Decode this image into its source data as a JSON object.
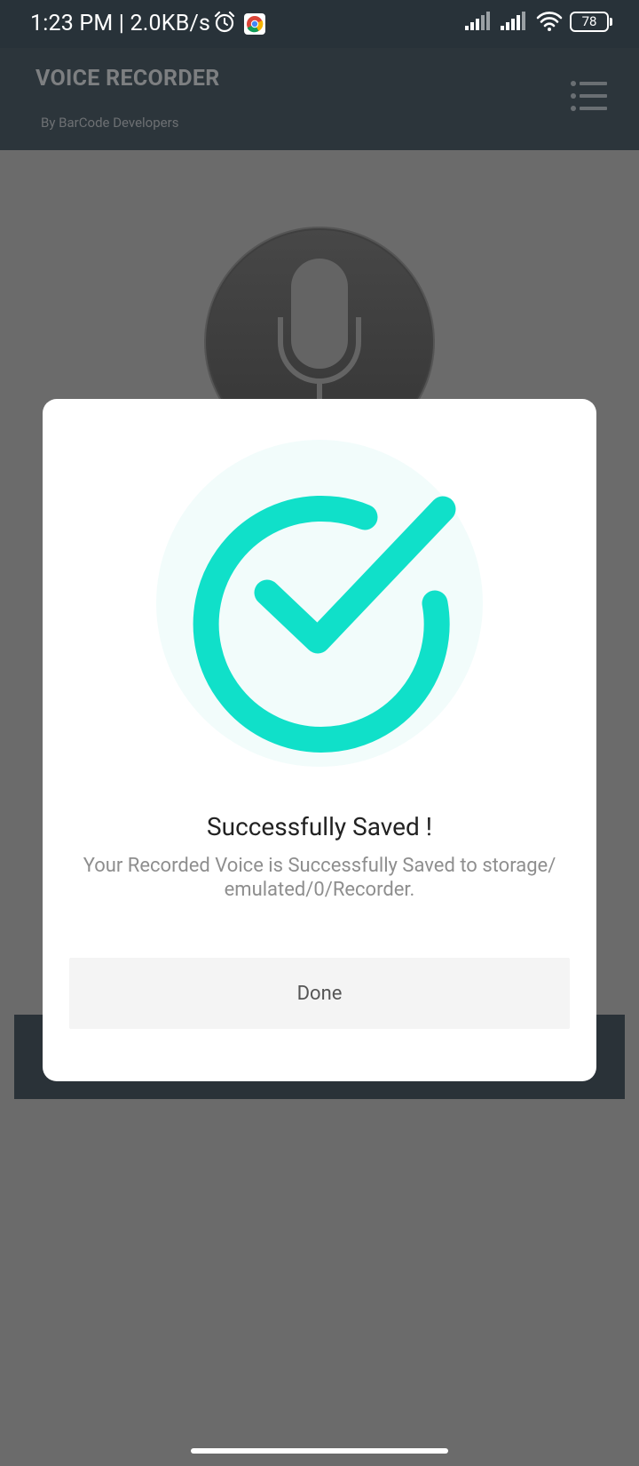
{
  "status_bar": {
    "text": "1:23 PM | 2.0KB/s",
    "battery": "78"
  },
  "app_bar": {
    "title": "VOICE RECORDER",
    "subtitle": "By BarCode Developers"
  },
  "dialog": {
    "title": "Successfully Saved !",
    "message": "Your Recorded Voice is Successfully Saved to storage/ emulated/0/Recorder.",
    "done_label": "Done"
  },
  "colors": {
    "accent": "#10e0c9",
    "app_bar": "#2c353b",
    "overlay": "#6b6b6b"
  },
  "icons": [
    "alarm-icon",
    "chrome-icon",
    "signal-icon",
    "wifi-icon",
    "battery-icon",
    "menu-list-icon",
    "microphone-icon",
    "success-check-icon"
  ]
}
